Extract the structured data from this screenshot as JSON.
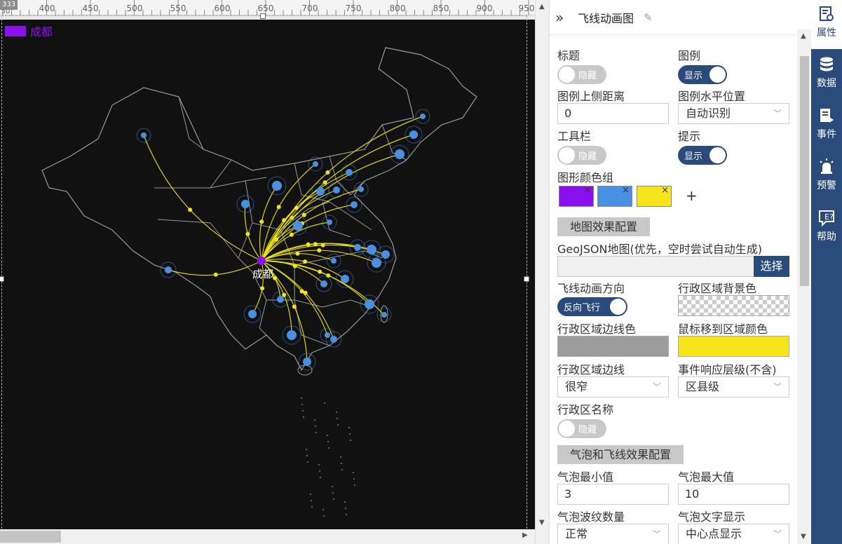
{
  "ruler": {
    "corner_label": "333",
    "marks": [
      "50",
      "400",
      "450",
      "500",
      "550",
      "600",
      "650",
      "700",
      "750",
      "800",
      "850",
      "900",
      "950"
    ]
  },
  "legend": {
    "label": "成都",
    "color": "#8b10f0"
  },
  "map": {
    "origin_label": "成都",
    "region_border_color": "#9a9a9a",
    "flyline_color": "#f2e51a",
    "bubble_color": "#4a90e2"
  },
  "panel": {
    "title": "飞线动画图",
    "props": {
      "title_label": "标题",
      "title_toggle": "隐藏",
      "legend_label": "图例",
      "legend_toggle": "显示",
      "legend_top_label": "图例上侧距离",
      "legend_top_value": "0",
      "legend_h_label": "图例水平位置",
      "legend_h_value": "自动识别",
      "toolbar_label": "工具栏",
      "toolbar_toggle": "隐藏",
      "tip_label": "提示",
      "tip_toggle": "显示",
      "palette_label": "图形颜色组",
      "palette_colors": [
        "#8b10f0",
        "#4a90e2",
        "#f7e51c"
      ],
      "palette_add": "+",
      "map_section": "地图效果配置",
      "geojson_label": "GeoJSON地图(优先，空时尝试自动生成)",
      "geojson_button": "选择",
      "direction_label": "飞线动画方向",
      "direction_toggle": "反向飞行",
      "region_bg_label": "行政区域背景色",
      "region_border_label": "行政区域边线色",
      "region_border_color": "#9b9b9b",
      "hover_color_label": "鼠标移到区域颜色",
      "hover_color": "#f7e51c",
      "border_width_label": "行政区域边线",
      "border_width_value": "很窄",
      "event_level_label": "事件响应层级(不含)",
      "event_level_value": "区县级",
      "region_name_label": "行政区名称",
      "region_name_toggle": "隐藏",
      "bubble_section": "气泡和飞线效果配置",
      "bubble_min_label": "气泡最小值",
      "bubble_min_value": "3",
      "bubble_max_label": "气泡最大值",
      "bubble_max_value": "10",
      "ripple_label": "气泡波纹数量",
      "ripple_value": "正常",
      "bubble_text_label": "气泡文字显示",
      "bubble_text_value": "中心点显示"
    }
  },
  "rail": {
    "items": [
      {
        "label": "属性",
        "icon": "properties-icon"
      },
      {
        "label": "数据",
        "icon": "database-icon"
      },
      {
        "label": "事件",
        "icon": "event-icon"
      },
      {
        "label": "预警",
        "icon": "alarm-icon"
      },
      {
        "label": "帮助",
        "icon": "help-icon"
      }
    ]
  },
  "colors": {
    "rail": "#2b4a7c",
    "toggle_on": "#2b4a7c",
    "toggle_off": "#c8c8c8"
  }
}
